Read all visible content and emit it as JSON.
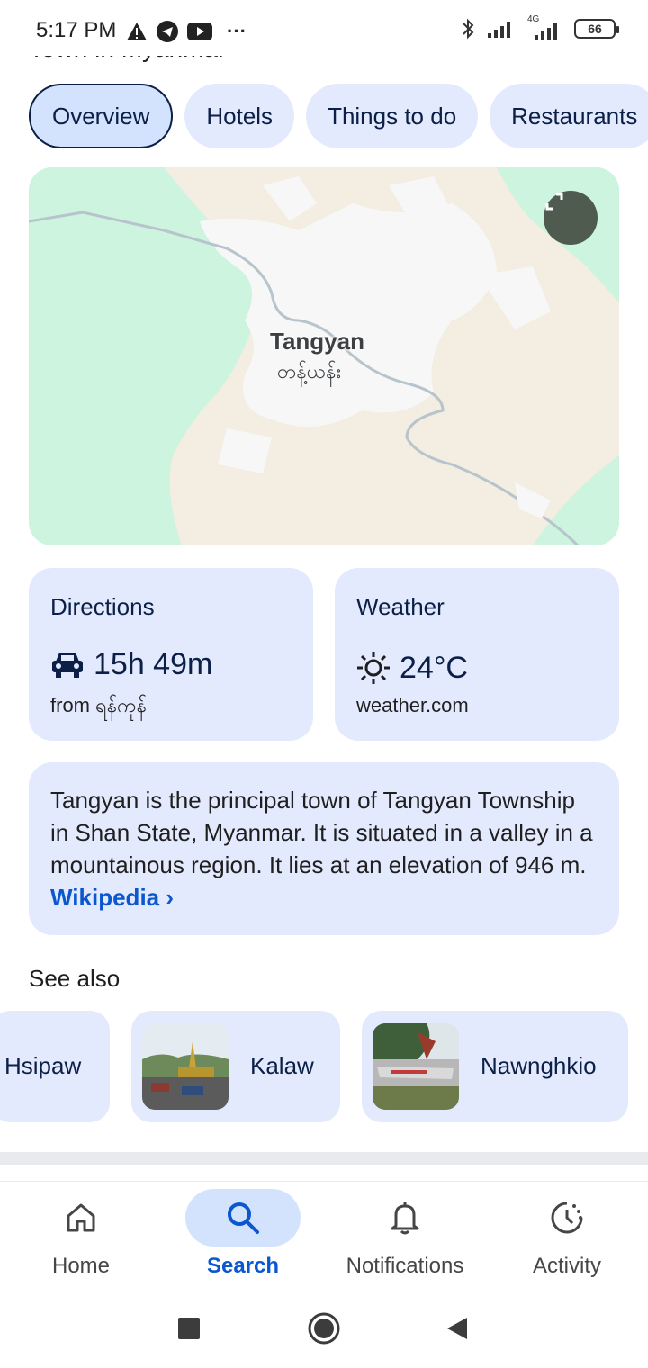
{
  "status_bar": {
    "time": "5:17 PM",
    "more": "···",
    "network": "4G",
    "battery": "66"
  },
  "heading_fragment": "Town in Myanmar",
  "tabs": [
    {
      "label": "Overview",
      "selected": true
    },
    {
      "label": "Hotels"
    },
    {
      "label": "Things to do"
    },
    {
      "label": "Restaurants"
    }
  ],
  "map": {
    "place_name": "Tangyan",
    "place_name_local": "တန့်ယန်း"
  },
  "directions": {
    "title": "Directions",
    "duration": "15h 49m",
    "from": "from ရန်ကုန်"
  },
  "weather": {
    "title": "Weather",
    "temperature": "24°C",
    "source": "weather.com"
  },
  "description": {
    "text": "Tangyan is the principal town of Tangyan Township in Shan State, Myanmar. It is situated in a valley in a mountainous region. It lies at an elevation of 946 m.",
    "source_link": "Wikipedia",
    "chevron": "›"
  },
  "see_also": {
    "title": "See also",
    "items": [
      {
        "name": "Hsipaw"
      },
      {
        "name": "Kalaw"
      },
      {
        "name": "Nawnghkio"
      }
    ]
  },
  "bottom_nav": [
    {
      "label": "Home",
      "icon": "home-icon"
    },
    {
      "label": "Search",
      "icon": "search-icon",
      "active": true
    },
    {
      "label": "Notifications",
      "icon": "bell-icon"
    },
    {
      "label": "Activity",
      "icon": "activity-icon"
    }
  ],
  "colors": {
    "accent": "#0b57d0",
    "card_bg": "#e3eafd",
    "chip_selected": "#d3e3fd"
  }
}
